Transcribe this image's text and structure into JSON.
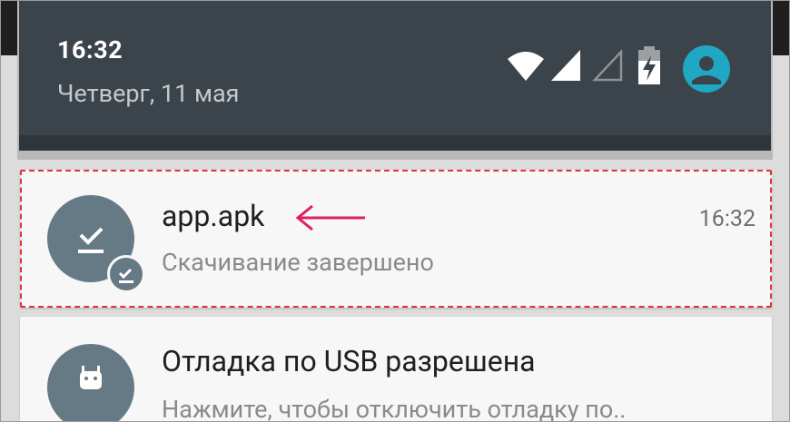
{
  "status_bar": {
    "time": "16:32",
    "date": "Четверг, 11 мая",
    "icons": [
      "wifi-icon",
      "signal-full-icon",
      "signal-empty-icon",
      "battery-charging-icon",
      "user-icon"
    ]
  },
  "notifications": [
    {
      "title": "app.apk",
      "subtitle": "Скачивание завершено",
      "time": "16:32",
      "icon": "download-done-icon",
      "highlighted": true,
      "arrow_color": "#e0205a"
    },
    {
      "title": "Отладка по USB разрешена",
      "subtitle": "Нажмите, чтобы отключить отладку по..",
      "icon": "android-icon"
    }
  ],
  "colors": {
    "panel": "#3c444b",
    "avatar": "#667a86",
    "accent_user": "#1fa7c4",
    "highlight_border": "#e0323c"
  }
}
